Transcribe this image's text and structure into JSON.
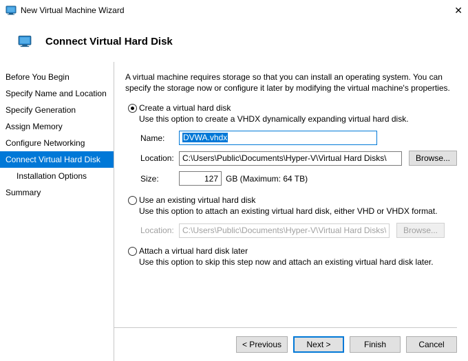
{
  "window": {
    "title": "New Virtual Machine Wizard"
  },
  "header": {
    "title": "Connect Virtual Hard Disk"
  },
  "sidebar": {
    "items": [
      {
        "label": "Before You Begin"
      },
      {
        "label": "Specify Name and Location"
      },
      {
        "label": "Specify Generation"
      },
      {
        "label": "Assign Memory"
      },
      {
        "label": "Configure Networking"
      },
      {
        "label": "Connect Virtual Hard Disk"
      },
      {
        "label": "Installation Options"
      },
      {
        "label": "Summary"
      }
    ]
  },
  "content": {
    "description": "A virtual machine requires storage so that you can install an operating system. You can specify the storage now or configure it later by modifying the virtual machine's properties.",
    "opt_create": {
      "title": "Create a virtual hard disk",
      "sub": "Use this option to create a VHDX dynamically expanding virtual hard disk.",
      "name_label": "Name:",
      "name_value": "DVWA.vhdx",
      "loc_label": "Location:",
      "loc_value": "C:\\Users\\Public\\Documents\\Hyper-V\\Virtual Hard Disks\\",
      "browse": "Browse...",
      "size_label": "Size:",
      "size_value": "127",
      "size_unit": "GB (Maximum: 64 TB)"
    },
    "opt_existing": {
      "title": "Use an existing virtual hard disk",
      "sub": "Use this option to attach an existing virtual hard disk, either VHD or VHDX format.",
      "loc_label": "Location:",
      "loc_value": "C:\\Users\\Public\\Documents\\Hyper-V\\Virtual Hard Disks\\",
      "browse": "Browse..."
    },
    "opt_later": {
      "title": "Attach a virtual hard disk later",
      "sub": "Use this option to skip this step now and attach an existing virtual hard disk later."
    }
  },
  "footer": {
    "prev": "< Previous",
    "next": "Next >",
    "finish": "Finish",
    "cancel": "Cancel"
  }
}
